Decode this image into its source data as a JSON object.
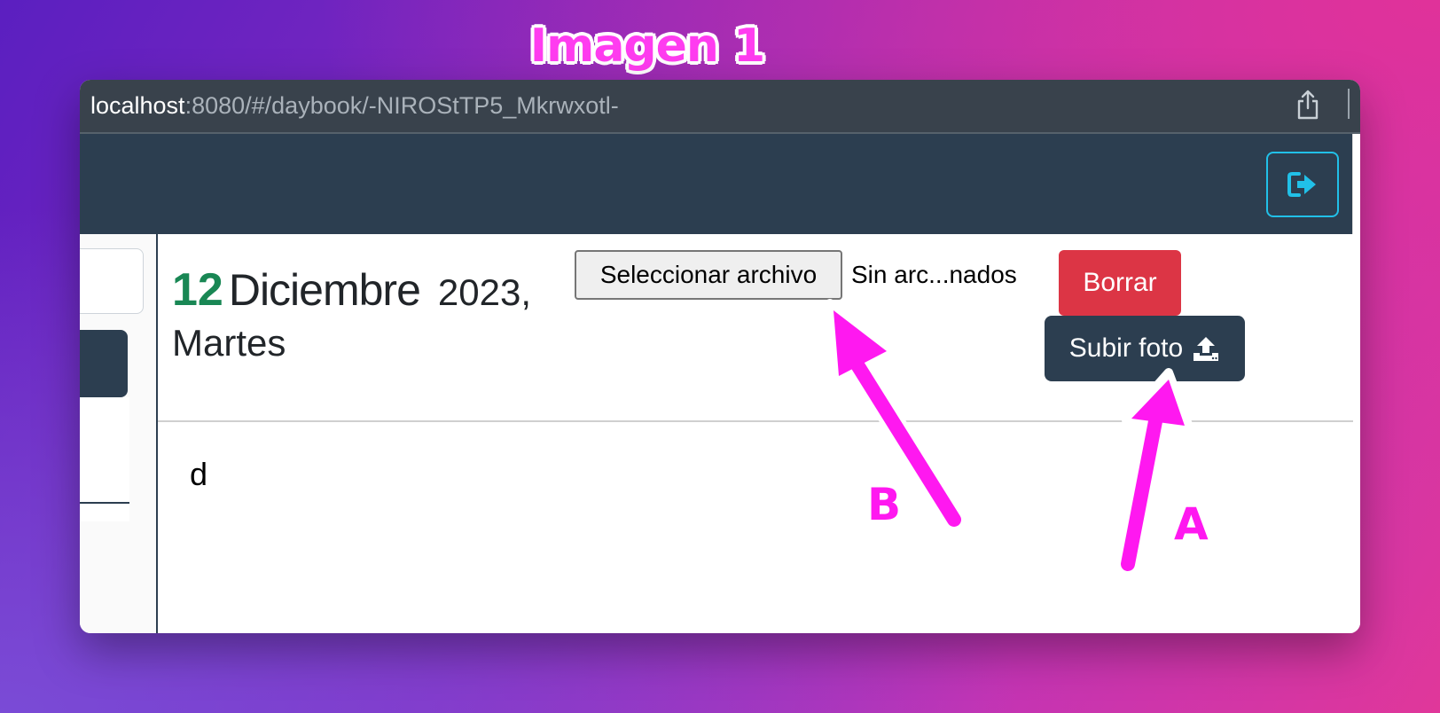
{
  "caption": "Imagen 1",
  "browser": {
    "url_host": "localhost",
    "url_rest": ":8080/#/daybook/-NIROStTP5_Mkrwxotl-"
  },
  "navbar": {
    "logout_icon": "sign-out-icon"
  },
  "entry": {
    "day": "12",
    "month": "Diciembre",
    "year": "2023,",
    "weekday": "Martes",
    "file_button_label": "Seleccionar archivo",
    "file_status": "Sin arc...nados",
    "delete_label": "Borrar",
    "upload_label": "Subir foto",
    "upload_icon": "upload-icon",
    "body_text": "d"
  },
  "annotations": {
    "label_b": "B",
    "label_a": "A",
    "arrow_color": "#ff18f0"
  },
  "colors": {
    "navbar": "#2c3e50",
    "danger": "#dc3545",
    "day": "#198754",
    "logout_border": "#21c0e8"
  }
}
